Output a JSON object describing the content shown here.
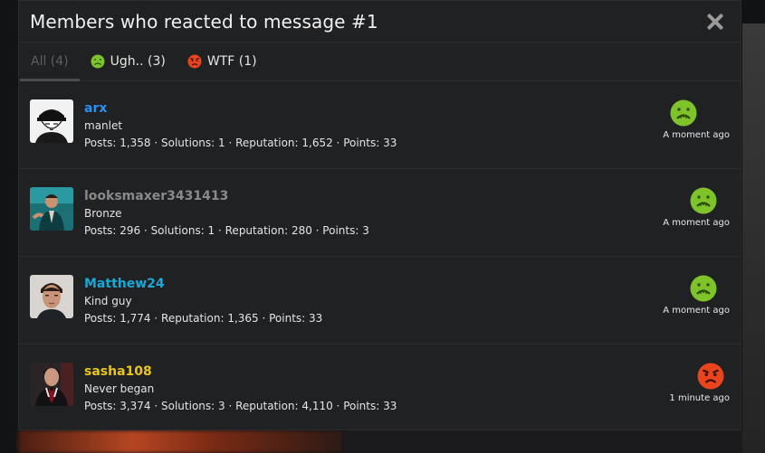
{
  "modal": {
    "title": "Members who reacted to message #1"
  },
  "tabs": [
    {
      "label": "All (4)",
      "active": true,
      "icon": null
    },
    {
      "label": "Ugh.. (3)",
      "active": false,
      "icon": "sick-emoji-icon"
    },
    {
      "label": "WTF (1)",
      "active": false,
      "icon": "angry-emoji-icon"
    }
  ],
  "members": [
    {
      "name": "arx",
      "name_color": "#2e8ff2",
      "title": "manlet",
      "stats": "Posts: 1,358 · Solutions: 1 · Reputation: 1,652 · Points: 33",
      "reaction": "sick-emoji-icon",
      "time": "A moment ago"
    },
    {
      "name": "looksmaxer3431413",
      "name_color": "#8a8a8a",
      "title": "Bronze",
      "stats": "Posts: 296 · Solutions: 1 · Reputation: 280 · Points: 3",
      "reaction": "sick-emoji-icon",
      "time": "A moment ago"
    },
    {
      "name": "Matthew24",
      "name_color": "#18a9d6",
      "title": "Kind guy",
      "stats": "Posts: 1,774 · Reputation: 1,365 · Points: 33",
      "reaction": "sick-emoji-icon",
      "time": "A moment ago"
    },
    {
      "name": "sasha108",
      "name_color": "#e8c51f",
      "title": "Never began",
      "stats": "Posts: 3,374 · Solutions: 3 · Reputation: 4,110 · Points: 33",
      "reaction": "angry-emoji-icon",
      "time": "1 minute ago"
    }
  ],
  "colors": {
    "sick_emoji": "#7ec32a",
    "angry_emoji": "#e8441d"
  }
}
